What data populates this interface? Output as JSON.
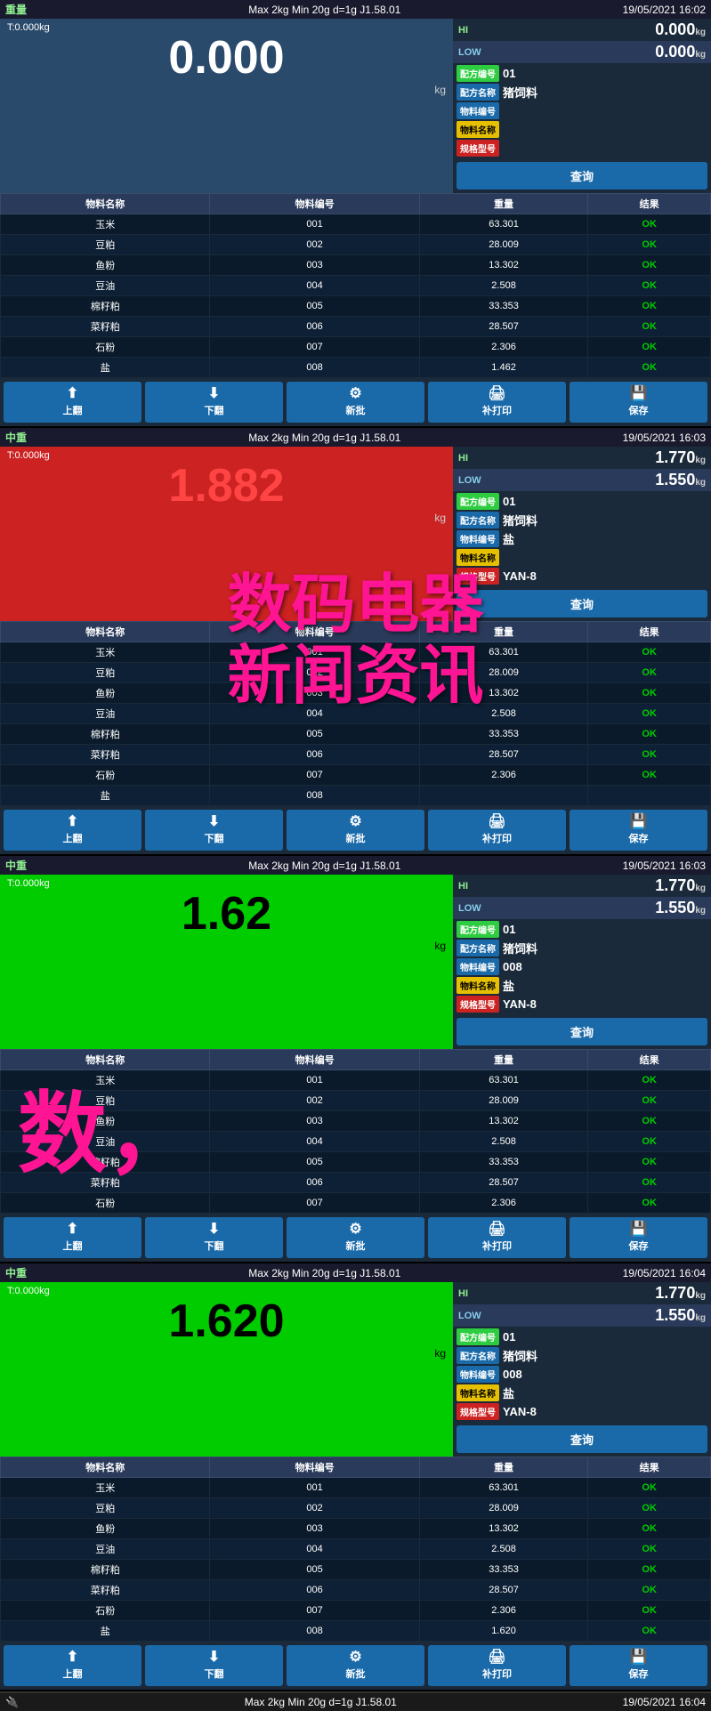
{
  "panels": [
    {
      "id": 1,
      "topbar": {
        "left": "重量",
        "center": "Max 2kg  Min 20g  d=1g    J1.58.01",
        "right": "19/05/2021  16:02"
      },
      "hi_label": "HI",
      "hi_value": "0.000",
      "hi_unit": "kg",
      "low_label": "LOW",
      "low_value": "0.000",
      "low_unit": "kg",
      "weight_value": "0.000",
      "weight_unit": "kg",
      "weight_color": "normal",
      "tare": "T:0.000kg",
      "info": [
        {
          "badge": "配方编号",
          "badge_color": "green",
          "value": "01"
        },
        {
          "badge": "配方名称",
          "badge_color": "blue",
          "value": "猪饲料"
        },
        {
          "badge": "物料编号",
          "badge_color": "blue",
          "value": ""
        },
        {
          "badge": "物料名称",
          "badge_color": "yellow",
          "value": ""
        },
        {
          "badge": "规格型号",
          "badge_color": "red",
          "value": ""
        }
      ],
      "query_btn": "查询",
      "table": {
        "headers": [
          "物料名称",
          "物料编号",
          "重量",
          "结果"
        ],
        "rows": [
          [
            "玉米",
            "001",
            "63.301",
            "OK"
          ],
          [
            "豆粕",
            "002",
            "28.009",
            "OK"
          ],
          [
            "鱼粉",
            "003",
            "13.302",
            "OK"
          ],
          [
            "豆油",
            "004",
            "2.508",
            "OK"
          ],
          [
            "棉籽粕",
            "005",
            "33.353",
            "OK"
          ],
          [
            "菜籽粕",
            "006",
            "28.507",
            "OK"
          ],
          [
            "石粉",
            "007",
            "2.306",
            "OK"
          ],
          [
            "盐",
            "008",
            "1.462",
            "OK"
          ]
        ]
      },
      "buttons": [
        {
          "icon": "⬆",
          "label": "上翻"
        },
        {
          "icon": "⬇",
          "label": "下翻"
        },
        {
          "icon": "⚙",
          "label": "新批"
        },
        {
          "icon": "🖨",
          "label": "补打印"
        },
        {
          "icon": "💾",
          "label": "保存"
        }
      ]
    },
    {
      "id": 2,
      "topbar": {
        "left": "中重",
        "center": "Max 2kg  Min 20g  d=1g    J1.58.01",
        "right": "19/05/2021  16:03"
      },
      "hi_label": "HI",
      "hi_value": "1.770",
      "hi_unit": "kg",
      "low_label": "LOW",
      "low_value": "1.550",
      "low_unit": "kg",
      "weight_value": "1.882",
      "weight_unit": "kg",
      "weight_color": "red",
      "tare": "T:0.000kg",
      "info": [
        {
          "badge": "配方编号",
          "badge_color": "green",
          "value": "01"
        },
        {
          "badge": "配方名称",
          "badge_color": "blue",
          "value": "猪饲料"
        },
        {
          "badge": "物料编号",
          "badge_color": "blue",
          "value": "盐"
        },
        {
          "badge": "物料名称",
          "badge_color": "yellow",
          "value": ""
        },
        {
          "badge": "规格型号",
          "badge_color": "red",
          "value": "YAN-8"
        }
      ],
      "query_btn": "查询",
      "watermark": [
        "数码电器",
        "新闻资讯"
      ],
      "table": {
        "headers": [
          "物料名称",
          "物料编号",
          "重量",
          "结果"
        ],
        "rows": [
          [
            "玉米",
            "001",
            "63.301",
            "OK"
          ],
          [
            "豆粕",
            "002",
            "28.009",
            "OK"
          ],
          [
            "鱼粉",
            "003",
            "13.302",
            "OK"
          ],
          [
            "豆油",
            "004",
            "2.508",
            "OK"
          ],
          [
            "棉籽粕",
            "005",
            "33.353",
            "OK"
          ],
          [
            "菜籽粕",
            "006",
            "28.507",
            "OK"
          ],
          [
            "石粉",
            "007",
            "2.306",
            "OK"
          ],
          [
            "盐",
            "008",
            "",
            ""
          ]
        ]
      },
      "buttons": [
        {
          "icon": "⬆",
          "label": "上翻"
        },
        {
          "icon": "⬇",
          "label": "下翻"
        },
        {
          "icon": "⚙",
          "label": "新批"
        },
        {
          "icon": "🖨",
          "label": "补打印"
        },
        {
          "icon": "💾",
          "label": "保存"
        }
      ]
    },
    {
      "id": 3,
      "topbar": {
        "left": "中重",
        "center": "Max 2kg  Min 20g  d=1g    J1.58.01",
        "right": "19/05/2021  16:03"
      },
      "hi_label": "HI",
      "hi_value": "1.770",
      "hi_unit": "kg",
      "low_label": "LOW",
      "low_value": "1.550",
      "low_unit": "kg",
      "weight_value": "1.62",
      "weight_unit": "kg",
      "weight_color": "green",
      "tare": "T:0.000kg",
      "info": [
        {
          "badge": "配方编号",
          "badge_color": "green",
          "value": "01"
        },
        {
          "badge": "配方名称",
          "badge_color": "blue",
          "value": "猪饲料"
        },
        {
          "badge": "物料编号",
          "badge_color": "blue",
          "value": "008"
        },
        {
          "badge": "物料名称",
          "badge_color": "yellow",
          "value": "盐"
        },
        {
          "badge": "规格型号",
          "badge_color": "red",
          "value": "YAN-8"
        }
      ],
      "query_btn": "查询",
      "watermark_partial": "数",
      "table": {
        "headers": [
          "物料名称",
          "物料编号",
          "重量",
          "结果"
        ],
        "rows": [
          [
            "玉米",
            "001",
            "63.301",
            "OK"
          ],
          [
            "豆粕",
            "002",
            "28.009",
            "OK"
          ],
          [
            "鱼粉",
            "003",
            "13.302",
            "OK"
          ],
          [
            "豆油",
            "004",
            "2.508",
            "OK"
          ],
          [
            "棉籽粕",
            "005",
            "33.353",
            "OK"
          ],
          [
            "菜籽粕",
            "006",
            "28.507",
            "OK"
          ],
          [
            "石粉",
            "007",
            "2.306",
            "OK"
          ]
        ]
      },
      "buttons": [
        {
          "icon": "⬆",
          "label": "上翻"
        },
        {
          "icon": "⬇",
          "label": "下翻"
        },
        {
          "icon": "⚙",
          "label": "新批"
        },
        {
          "icon": "🖨",
          "label": "补打印"
        },
        {
          "icon": "💾",
          "label": "保存"
        }
      ]
    },
    {
      "id": 4,
      "topbar": {
        "left": "中重",
        "center": "Max 2kg  Min 20g  d=1g    J1.58.01",
        "right": "19/05/2021  16:04"
      },
      "hi_label": "HI",
      "hi_value": "1.770",
      "hi_unit": "kg",
      "low_label": "LOW",
      "low_value": "1.550",
      "low_unit": "kg",
      "weight_value": "1.620",
      "weight_unit": "kg",
      "weight_color": "green",
      "tare": "T:0.000kg",
      "info": [
        {
          "badge": "配方编号",
          "badge_color": "green",
          "value": "01"
        },
        {
          "badge": "配方名称",
          "badge_color": "blue",
          "value": "猪饲料"
        },
        {
          "badge": "物料编号",
          "badge_color": "blue",
          "value": "008"
        },
        {
          "badge": "物料名称",
          "badge_color": "yellow",
          "value": "盐"
        },
        {
          "badge": "规格型号",
          "badge_color": "red",
          "value": "YAN-8"
        }
      ],
      "query_btn": "查询",
      "table": {
        "headers": [
          "物料名称",
          "物料编号",
          "重量",
          "结果"
        ],
        "rows": [
          [
            "玉米",
            "001",
            "63.301",
            "OK"
          ],
          [
            "豆粕",
            "002",
            "28.009",
            "OK"
          ],
          [
            "鱼粉",
            "003",
            "13.302",
            "OK"
          ],
          [
            "豆油",
            "004",
            "2.508",
            "OK"
          ],
          [
            "棉籽粕",
            "005",
            "33.353",
            "OK"
          ],
          [
            "菜籽粕",
            "006",
            "28.507",
            "OK"
          ],
          [
            "石粉",
            "007",
            "2.306",
            "OK"
          ],
          [
            "盐",
            "008",
            "1.620",
            "OK"
          ]
        ]
      },
      "buttons": [
        {
          "icon": "⬆",
          "label": "上翻"
        },
        {
          "icon": "⬇",
          "label": "下翻"
        },
        {
          "icon": "⚙",
          "label": "新批"
        },
        {
          "icon": "🖨",
          "label": "补打印"
        },
        {
          "icon": "💾",
          "label": "保存"
        }
      ]
    }
  ],
  "bottombar": {
    "left": "🔌",
    "center": "Max 2kg  Min 20g  d=1g    J1.58.01",
    "right": "19/05/2021  16:04"
  }
}
